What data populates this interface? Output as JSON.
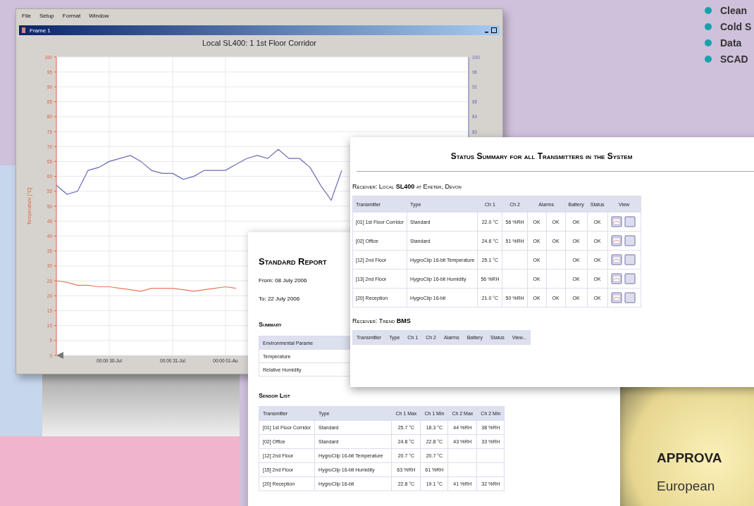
{
  "bullets": [
    "Clean",
    "Cold S",
    "Data",
    "SCAD"
  ],
  "chart_window": {
    "menu": [
      "File",
      "Setup",
      "Format",
      "Window"
    ],
    "title": "Frame 1",
    "chart_title": "Local SL400: 1 1st Floor Corridor",
    "right_axis_labels": [
      "100",
      "96",
      "92",
      "88",
      "84",
      "80"
    ],
    "chart_data": {
      "type": "line",
      "ylabel": "Temperature [°C]",
      "grid": true,
      "categories": [
        null,
        null,
        null,
        null,
        null,
        "00:00 30-Jul",
        null,
        null,
        null,
        null,
        null,
        "00:00 31-Jul",
        null,
        null,
        null,
        null,
        "00:00 01-Au",
        null,
        null,
        null,
        null,
        null,
        null,
        null,
        null,
        null,
        null,
        null,
        null,
        null,
        null,
        null,
        null,
        null,
        null,
        null,
        null,
        null,
        null,
        null
      ],
      "ylim": [
        0,
        100
      ],
      "yticks": [
        0,
        5,
        10,
        15,
        20,
        25,
        30,
        35,
        40,
        45,
        50,
        55,
        60,
        65,
        70,
        75,
        80,
        85,
        90,
        95,
        100
      ],
      "series": [
        {
          "color": "#6a6ab8",
          "values": [
            57,
            54,
            55,
            62,
            63,
            65,
            66,
            67,
            65,
            62,
            61,
            61,
            59,
            60,
            62,
            62,
            62,
            64,
            66,
            67,
            66,
            69,
            66,
            66,
            63,
            57,
            52,
            62,
            null,
            null,
            null,
            null,
            null,
            null,
            null,
            null,
            null,
            null,
            null,
            null
          ]
        },
        {
          "color": "#e8785a",
          "values": [
            25,
            24.5,
            23.5,
            23.5,
            23,
            23,
            22.5,
            22,
            21.5,
            22.5,
            22.5,
            22.5,
            22,
            21.5,
            22,
            22.5,
            23,
            22.5,
            null,
            null,
            null,
            null,
            null,
            null,
            null,
            null,
            null,
            null,
            null,
            null,
            null,
            null,
            null,
            null,
            null,
            null,
            null,
            null,
            null,
            null
          ]
        }
      ]
    }
  },
  "report": {
    "title": "Standard Report",
    "from": "From: 08 July 2006",
    "to": "To: 22 July 2006",
    "summary_heading": "Summary",
    "summary_rows": [
      "Environmental Parame",
      "Temperature",
      "Relative Humidity"
    ],
    "sensor_heading": "Sensor List",
    "sensor_columns": [
      "Transmitter",
      "Type",
      "Ch 1 Max",
      "Ch 1 Min",
      "Ch 2 Max",
      "Ch 2 Min"
    ],
    "sensor_rows": [
      [
        "[01] 1st Floor Corridor",
        "Standard",
        "25.7 °C",
        "18.3 °C",
        "44 %RH",
        "38 %RH"
      ],
      [
        "[02] Office",
        "Standard",
        "24.8 °C",
        "22.8 °C",
        "43 %RH",
        "33 %RH"
      ],
      [
        "[12] 2nd Floor",
        "HygroClip 16-bit Temperature",
        "20.7 °C",
        "20.7 °C",
        "",
        ""
      ],
      [
        "[15] 2nd Floor",
        "HygroClip 16-bit Humidity",
        "63 %RH",
        "61 %RH",
        "",
        ""
      ],
      [
        "[20] Reception",
        "HygroClip 16-bit",
        "22.8 °C",
        "19.1 °C",
        "41 %RH",
        "32 %RH"
      ]
    ]
  },
  "status": {
    "title": "Status Summary for all Transmitters in the System",
    "receiver_1": "Receiver: Local **SL400** at Exeter, Devon",
    "columns": [
      "Transmitter",
      "Type",
      "Ch 1",
      "Ch 2",
      "Alarms",
      "Battery",
      "Status",
      "View"
    ],
    "rows": [
      [
        "[01] 1st Floor Corridor",
        "Standard",
        "22.0 °C",
        "56 %RH",
        [
          "OK",
          "OK"
        ],
        "OK",
        "OK"
      ],
      [
        "[02] Office",
        "Standard",
        "24.6 °C",
        "51 %RH",
        [
          "OK",
          "OK"
        ],
        "OK",
        "OK"
      ],
      [
        "[12] 2nd Floor",
        "HygroClip 16-bit Temperature",
        "25.1 °C",
        "",
        [
          "OK",
          ""
        ],
        "OK",
        "OK"
      ],
      [
        "[13] 2nd Floor",
        "HygroClip 16-bit Humidity",
        "56 %RH",
        "",
        [
          "OK",
          ""
        ],
        "OK",
        "OK"
      ],
      [
        "[20] Reception",
        "HygroClip 16-bit",
        "21.0 °C",
        "50 %RH",
        [
          "OK",
          "OK"
        ],
        "OK",
        "OK"
      ]
    ],
    "receiver_2": "Receiver: Trend **BMS**",
    "columns_2": [
      "Transmitter",
      "Type",
      "Ch 1",
      "Ch 2",
      "Alarms",
      "Battery",
      "Status",
      "View..."
    ]
  },
  "approvals": {
    "heading": "APPROVA",
    "text": "European"
  }
}
